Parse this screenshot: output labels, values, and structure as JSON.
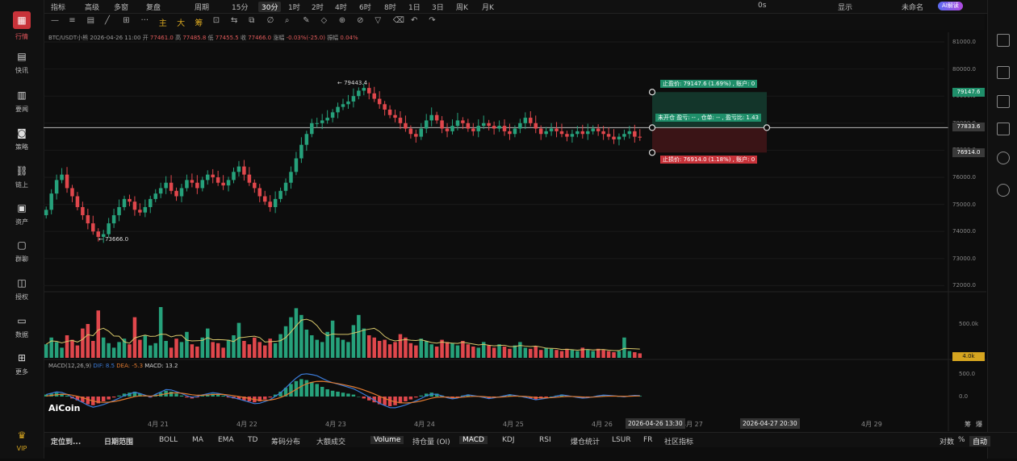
{
  "nav": [
    {
      "label": "行情",
      "icon": "chart-grid-icon",
      "active": true
    },
    {
      "label": "快讯",
      "icon": "news-flash-icon"
    },
    {
      "label": "要闻",
      "icon": "document-icon"
    },
    {
      "label": "策略",
      "icon": "robot-icon"
    },
    {
      "label": "链上",
      "icon": "chain-icon"
    },
    {
      "label": "资产",
      "icon": "wallet-icon"
    },
    {
      "label": "群聊",
      "icon": "chat-icon"
    },
    {
      "label": "授权",
      "icon": "authorize-icon"
    },
    {
      "label": "数据",
      "icon": "monitor-icon"
    },
    {
      "label": "更多",
      "icon": "grid-more-icon"
    },
    {
      "label": "VIP",
      "icon": "crown-icon"
    }
  ],
  "topbar": {
    "left_items": [
      "指标",
      "高级",
      "多窗",
      "复盘",
      "周期",
      "15分",
      "30分",
      "1时",
      "2时",
      "4时",
      "6时",
      "8时",
      "1日",
      "3日",
      "周K",
      "月K"
    ],
    "active": "30分",
    "right_items": [
      "0s",
      "显示",
      "未命名"
    ],
    "ai_label": "AI解读"
  },
  "toolbar2": {
    "tools": [
      "—",
      "≡",
      "▤",
      "╱",
      "⊞",
      "···",
      "主",
      "大",
      "筹",
      "⊡",
      "⇆",
      "⧉",
      "∅",
      "⌕",
      "✎",
      "◇",
      "⊕",
      "⊘",
      "▽",
      "⌫",
      "↶",
      "↷"
    ]
  },
  "legend": {
    "symbol": "BTC/USDT小熊 2026-04-26 11:00",
    "open_l": "开",
    "open": "77461.0",
    "high_l": "高",
    "high": "77485.8",
    "low_l": "低",
    "low": "77455.5",
    "close_l": "收",
    "close": "77466.0",
    "chg_l": "涨幅",
    "chg": "-0.03%(-25.0)",
    "amp_l": "振幅",
    "amp": "0.04%"
  },
  "y_axis": [
    "81000.0",
    "80000.0",
    "79000.0",
    "78000.0",
    "77000.0",
    "76000.0",
    "75000.0",
    "74000.0",
    "73000.0",
    "72000.0"
  ],
  "price_tags": {
    "tp": "79147.6",
    "last": "77833.6",
    "sl": "76914.0",
    "vol": "4.0k"
  },
  "extremes": {
    "high": "← 79443.4",
    "low": "← 73666.0"
  },
  "position_tool": {
    "tp_label": "止盈价: 79147.6 (1.69%) , 账户: 0",
    "mid_label": "未开仓 盈亏: -- , 仓单: -- , 盈亏比: 1.43",
    "sl_label": "止损价: 76914.0 (1.18%) , 账户: 0"
  },
  "volume_axis": [
    "500.0k"
  ],
  "macd": {
    "title": "MACD(12,26,9)",
    "dif": "DIF: 8.5",
    "dea": "DEA: -5.3",
    "macd": "MACD: 13.2",
    "axis": [
      "500.0",
      "0.0"
    ]
  },
  "logo": "AiCoin",
  "x_axis": [
    "4月 21",
    "4月 22",
    "4月 23",
    "4月 24",
    "4月 25",
    "4月 26",
    "4月 27",
    "4月 29"
  ],
  "x_highlights": [
    "2026-04-26 13:30",
    "2026-04-27 20:30"
  ],
  "x_right": [
    "筹",
    "爆"
  ],
  "bottom": {
    "left": [
      "定位到...",
      "日期范围"
    ],
    "items": [
      "BOLL",
      "MA",
      "EMA",
      "TD",
      "筹码分布",
      "大额成交",
      "Volume",
      "持仓量 (OI)",
      "MACD",
      "KDJ",
      "RSI",
      "爆仓统计",
      "LSUR",
      "FR",
      "社区指标"
    ],
    "active": [
      "Volume",
      "MACD"
    ],
    "right": [
      "对数",
      "%",
      "自动"
    ]
  },
  "colors": {
    "up": "#26a17b",
    "down": "#e0474c",
    "accent": "#d6a520",
    "tp": "#1f8f6a",
    "sl": "#c8333a"
  },
  "chart_data": {
    "type": "candlestick",
    "timeframe": "30分",
    "ylim": [
      72000,
      81000
    ],
    "closes": [
      74800,
      75400,
      75900,
      76100,
      75600,
      75300,
      74900,
      74600,
      74300,
      74000,
      73800,
      73900,
      74300,
      74600,
      74900,
      75200,
      75100,
      74800,
      74700,
      74900,
      75200,
      75400,
      75600,
      75800,
      75500,
      75300,
      75600,
      75900,
      75800,
      75600,
      75900,
      76100,
      76000,
      75800,
      75700,
      75900,
      76200,
      76400,
      76100,
      75800,
      75600,
      75300,
      75100,
      74900,
      75200,
      75500,
      75800,
      76200,
      76700,
      77200,
      77600,
      78000,
      78000,
      78100,
      78200,
      78400,
      78600,
      78700,
      78800,
      79000,
      79200,
      79300,
      79100,
      78900,
      78700,
      78500,
      78300,
      78200,
      78000,
      77800,
      77600,
      77500,
      77800,
      78100,
      78300,
      78100,
      77800,
      77700,
      77900,
      78100,
      78000,
      77800,
      77700,
      77900,
      78000,
      77900,
      77800,
      77900,
      77700,
      77600,
      77800,
      78000,
      78200,
      78000,
      77800,
      77600,
      77700,
      77800,
      77700,
      77600,
      77500,
      77600,
      77700,
      77600,
      77700,
      77800,
      77700,
      77600,
      77500,
      77400,
      77500,
      77600,
      77700,
      77500,
      77466
    ],
    "extremes": {
      "high": 79443.4,
      "low": 73666.0
    },
    "volumes_k": [
      120,
      180,
      140,
      90,
      200,
      160,
      110,
      260,
      300,
      150,
      420,
      180,
      130,
      90,
      140,
      170,
      120,
      360,
      160,
      200,
      110,
      130,
      450,
      150,
      90,
      170,
      140,
      230,
      120,
      100,
      180,
      260,
      140,
      130,
      90,
      160,
      200,
      310,
      150,
      120,
      180,
      140,
      110,
      170,
      130,
      210,
      280,
      360,
      440,
      380,
      250,
      200,
      160,
      140,
      230,
      330,
      180,
      160,
      140,
      290,
      380,
      260,
      200,
      180,
      150,
      160,
      120,
      140,
      210,
      180,
      130,
      110,
      170,
      150,
      120,
      100,
      160,
      140,
      130,
      110,
      150,
      120,
      100,
      90,
      140,
      110,
      90,
      120,
      100,
      80,
      110,
      140,
      90,
      80,
      100,
      70,
      90,
      80,
      70,
      60,
      80,
      70,
      60,
      90,
      70,
      60,
      80,
      70,
      60,
      50,
      60,
      180,
      60,
      50,
      40
    ],
    "macd_hist": [
      40,
      60,
      80,
      60,
      20,
      -40,
      -80,
      -120,
      -160,
      -180,
      -140,
      -100,
      -60,
      -20,
      20,
      60,
      80,
      100,
      60,
      20,
      -20,
      40,
      80,
      120,
      100,
      60,
      20,
      -20,
      -40,
      -20,
      20,
      40,
      60,
      40,
      20,
      -20,
      -40,
      -60,
      -80,
      -100,
      -120,
      -100,
      -60,
      -20,
      40,
      100,
      180,
      260,
      320,
      360,
      340,
      300,
      260,
      200,
      150,
      120,
      100,
      80,
      60,
      40,
      0,
      -40,
      -80,
      -120,
      -160,
      -180,
      -200,
      -180,
      -140,
      -100,
      -60,
      -20,
      20,
      60,
      80,
      60,
      20,
      -20,
      -40,
      -20,
      20,
      40,
      20,
      0,
      -20,
      -40,
      -20,
      0,
      20,
      40,
      20,
      0,
      -20,
      -40,
      -60,
      -40,
      -20,
      0,
      20,
      40,
      20,
      0,
      -20,
      -30,
      -20,
      0,
      20,
      30,
      20,
      10,
      0,
      -10,
      10,
      20,
      13
    ]
  }
}
